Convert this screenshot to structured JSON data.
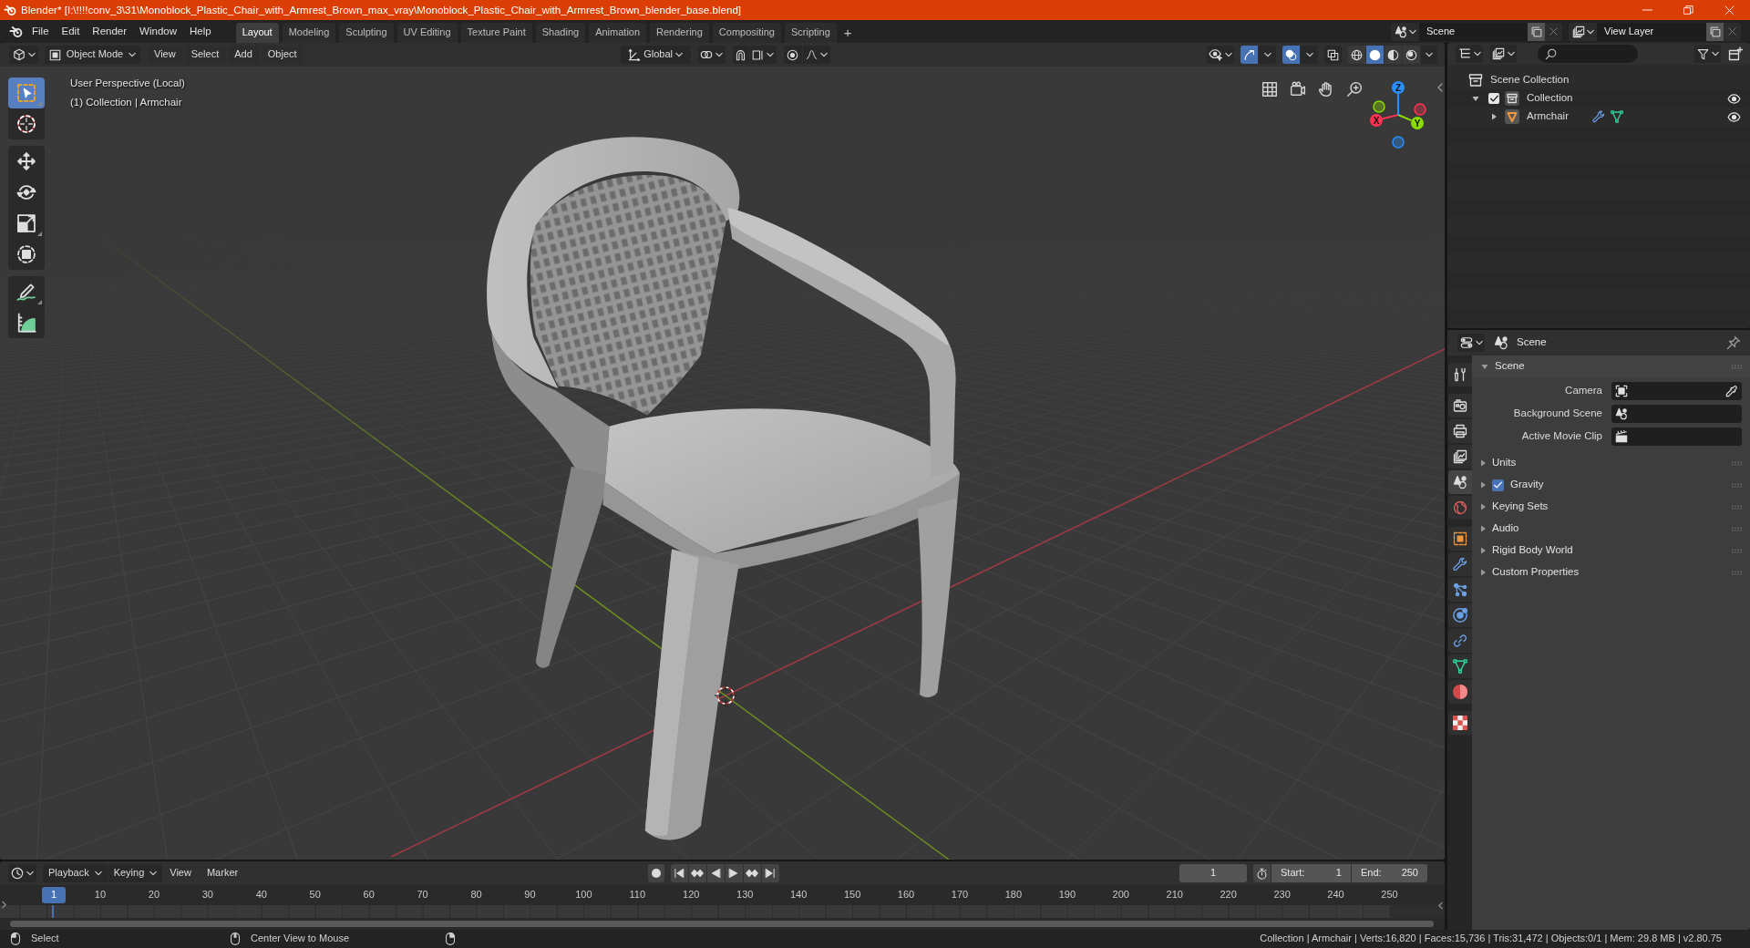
{
  "title_bar": {
    "title": "Blender* [I:\\!!!!conv_3\\31\\Monoblock_Plastic_Chair_with_Armrest_Brown_max_vray\\Monoblock_Plastic_Chair_with_Armrest_Brown_blender_base.blend]"
  },
  "top_bar": {
    "menus": [
      "File",
      "Edit",
      "Render",
      "Window",
      "Help"
    ],
    "workspaces": [
      {
        "label": "Layout",
        "selected": true
      },
      {
        "label": "Modeling",
        "selected": false
      },
      {
        "label": "Sculpting",
        "selected": false
      },
      {
        "label": "UV Editing",
        "selected": false
      },
      {
        "label": "Texture Paint",
        "selected": false
      },
      {
        "label": "Shading",
        "selected": false
      },
      {
        "label": "Animation",
        "selected": false
      },
      {
        "label": "Rendering",
        "selected": false
      },
      {
        "label": "Compositing",
        "selected": false
      },
      {
        "label": "Scripting",
        "selected": false
      }
    ],
    "add_workspace": "+",
    "scene": "Scene",
    "view_layer": "View Layer"
  },
  "viewport": {
    "header": {
      "mode": "Object Mode",
      "menus": [
        "View",
        "Select",
        "Add",
        "Object"
      ],
      "orientation": "Global",
      "toggles": [
        {
          "kind": "gizmos",
          "on": true
        },
        {
          "kind": "overlays",
          "on": true
        },
        {
          "kind": "xray",
          "on": false
        }
      ],
      "shading": [
        {
          "kind": "wireframe",
          "selected": false
        },
        {
          "kind": "solid",
          "selected": true
        },
        {
          "kind": "material",
          "selected": false
        },
        {
          "kind": "rendered",
          "selected": false
        }
      ]
    },
    "tools": [
      {
        "kind": "select_box",
        "selected": true
      },
      {
        "kind": "cursor",
        "selected": false
      },
      {
        "kind": "move",
        "selected": false
      },
      {
        "kind": "rotate",
        "selected": false
      },
      {
        "kind": "scale",
        "selected": false
      },
      {
        "kind": "transform",
        "selected": false
      },
      {
        "kind": "annotate",
        "selected": false
      },
      {
        "kind": "measure",
        "selected": false
      }
    ],
    "info": [
      "User Perspective (Local)",
      "(1) Collection | Armchair"
    ],
    "gizmo_axes": [
      {
        "label": "X",
        "color": "#ff3352"
      },
      {
        "label": "Y",
        "color": "#8bdc00"
      },
      {
        "label": "Z",
        "color": "#2890ff"
      }
    ]
  },
  "outliner": {
    "items": [
      {
        "label": "Scene Collection",
        "kind": "scene_collection",
        "children": [
          {
            "label": "Collection",
            "kind": "collection",
            "expanded": true,
            "checked": true,
            "visible": true,
            "children": [
              {
                "label": "Armchair",
                "kind": "mesh_object",
                "expanded": false,
                "visible": true
              }
            ]
          }
        ]
      }
    ]
  },
  "properties": {
    "context": "Scene",
    "tabs": [
      {
        "kind": "tool",
        "selected": false
      },
      {
        "kind": "render",
        "selected": false
      },
      {
        "kind": "output",
        "selected": false
      },
      {
        "kind": "view_layer",
        "selected": false
      },
      {
        "kind": "scene",
        "selected": true
      },
      {
        "kind": "world",
        "selected": false
      },
      {
        "kind": "object",
        "selected": false
      },
      {
        "kind": "modifiers",
        "selected": false
      },
      {
        "kind": "particles",
        "selected": false
      },
      {
        "kind": "physics",
        "selected": false
      },
      {
        "kind": "constraints",
        "selected": false
      },
      {
        "kind": "data",
        "selected": false
      },
      {
        "kind": "material",
        "selected": false
      },
      {
        "kind": "texture",
        "selected": false
      }
    ],
    "panels": [
      {
        "label": "Scene",
        "expanded": true,
        "fields": [
          {
            "label": "Camera",
            "kind": "camera"
          },
          {
            "label": "Background Scene",
            "kind": "scene"
          },
          {
            "label": "Active Movie Clip",
            "kind": "clip"
          }
        ]
      },
      {
        "label": "Units",
        "expanded": false
      },
      {
        "label": "Gravity",
        "expanded": false,
        "checked": true
      },
      {
        "label": "Keying Sets",
        "expanded": false
      },
      {
        "label": "Audio",
        "expanded": false
      },
      {
        "label": "Rigid Body World",
        "expanded": false
      },
      {
        "label": "Custom Properties",
        "expanded": false
      }
    ]
  },
  "timeline": {
    "menus": [
      {
        "label": "Playback",
        "dropdown": true
      },
      {
        "label": "Keying",
        "dropdown": true
      },
      {
        "label": "View",
        "dropdown": false
      },
      {
        "label": "Marker",
        "dropdown": false
      }
    ],
    "current_frame": "1",
    "start_label": "Start:",
    "start": "1",
    "end_label": "End:",
    "end": "250",
    "playhead": "1",
    "ruler": [
      "10",
      "20",
      "30",
      "40",
      "50",
      "60",
      "70",
      "80",
      "90",
      "100",
      "110",
      "120",
      "130",
      "140",
      "150",
      "160",
      "170",
      "180",
      "190",
      "200",
      "210",
      "220",
      "230",
      "240",
      "250"
    ]
  },
  "status_bar": {
    "hints": [
      "Select",
      "Center View to Mouse"
    ],
    "stats": "Collection | Armchair | Verts:16,820 | Faces:15,736 | Tris:31,472 | Objects:0/1 | Mem: 29.8 MB | v2.80.75"
  }
}
